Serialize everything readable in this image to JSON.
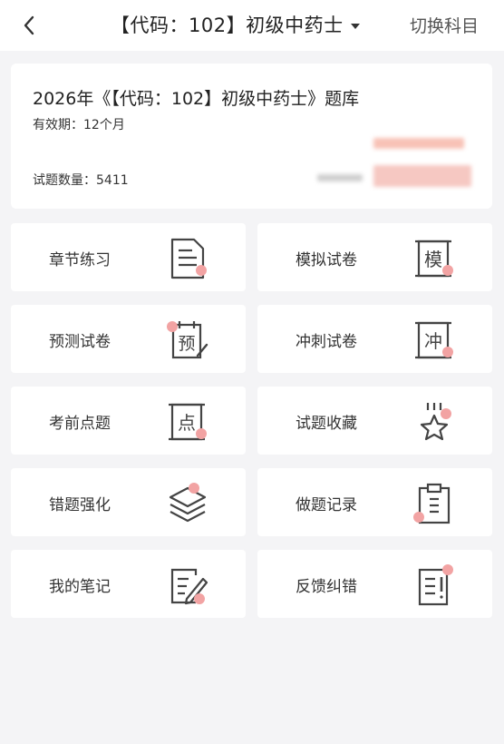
{
  "header": {
    "back_icon": "chevron-left-icon",
    "title": "【代码：102】初级中药士",
    "dropdown_icon": "caret-down-icon",
    "switch_label": "切换科目"
  },
  "bank": {
    "title": "2026年《【代码：102】初级中药士》题库",
    "validity": "有效期：12个月",
    "count": "试题数量：5411"
  },
  "colors": {
    "accent_dot": "#f2a3a3",
    "icon_stroke": "#444444",
    "background": "#f4f4f6"
  },
  "menu": [
    {
      "label": "章节练习",
      "icon": "document-list-icon"
    },
    {
      "label": "模拟试卷",
      "icon": "scroll-mo-icon"
    },
    {
      "label": "预测试卷",
      "icon": "calendar-yu-icon"
    },
    {
      "label": "冲刺试卷",
      "icon": "scroll-chong-icon"
    },
    {
      "label": "考前点题",
      "icon": "scroll-dian-icon"
    },
    {
      "label": "试题收藏",
      "icon": "star-icon"
    },
    {
      "label": "错题强化",
      "icon": "layers-icon"
    },
    {
      "label": "做题记录",
      "icon": "clipboard-icon"
    },
    {
      "label": "我的笔记",
      "icon": "note-edit-icon"
    },
    {
      "label": "反馈纠错",
      "icon": "feedback-icon"
    }
  ],
  "icon_glyphs": {
    "mo": "模",
    "yu": "预",
    "chong": "冲",
    "dian": "点"
  }
}
